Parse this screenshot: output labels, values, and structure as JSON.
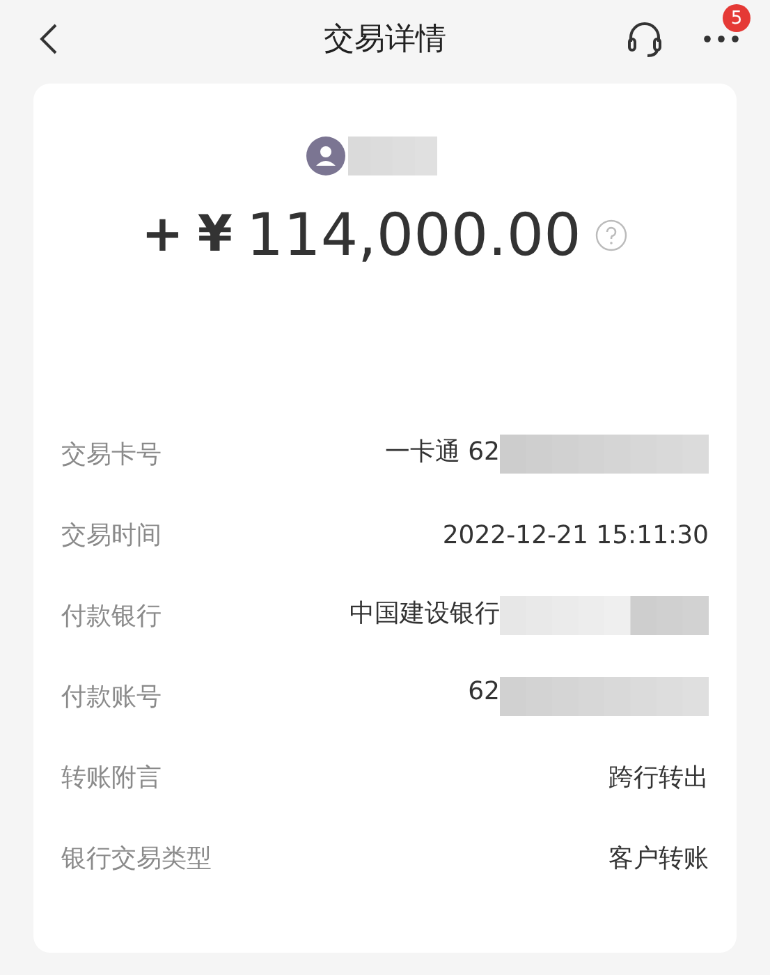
{
  "header": {
    "title": "交易详情",
    "badge": "5"
  },
  "payer": {
    "name_redacted": true
  },
  "amount": {
    "sign": "+",
    "currency": "¥",
    "value": "114,000.00"
  },
  "details": [
    {
      "label": "交易卡号",
      "value": "一卡通 62",
      "redacted": true
    },
    {
      "label": "交易时间",
      "value": "2022-12-21 15:11:30",
      "redacted": false
    },
    {
      "label": "付款银行",
      "value": "中国建设银行",
      "redacted": true
    },
    {
      "label": "付款账号",
      "value": "62",
      "redacted": true
    },
    {
      "label": "转账附言",
      "value": "跨行转出",
      "redacted": false
    },
    {
      "label": "银行交易类型",
      "value": "客户转账",
      "redacted": false
    }
  ]
}
